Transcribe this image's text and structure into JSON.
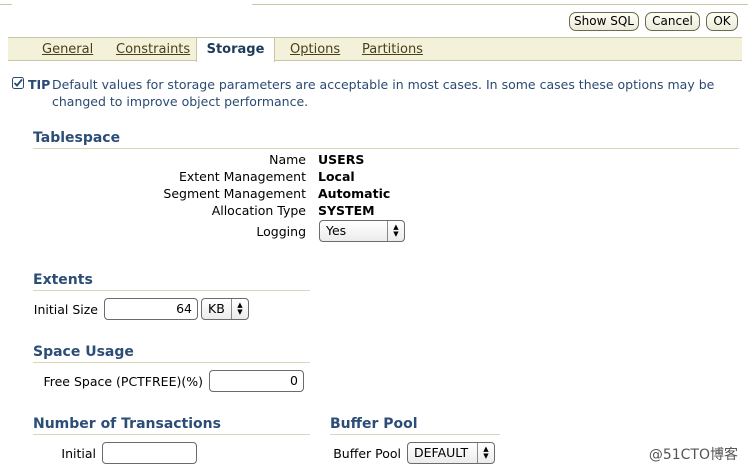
{
  "header": {
    "show_sql": "Show SQL",
    "cancel": "Cancel",
    "ok": "OK"
  },
  "tabs": {
    "general": "General",
    "constraints": "Constraints",
    "storage": "Storage",
    "options": "Options",
    "partitions": "Partitions"
  },
  "tip": {
    "label": "TIP",
    "text": "Default values for storage parameters are acceptable in most cases. In some cases these options may be changed to improve object performance."
  },
  "tablespace": {
    "title": "Tablespace",
    "name_label": "Name",
    "name_value": "USERS",
    "extent_label": "Extent Management",
    "extent_value": "Local",
    "segment_label": "Segment Management",
    "segment_value": "Automatic",
    "allocation_label": "Allocation Type",
    "allocation_value": "SYSTEM",
    "logging_label": "Logging",
    "logging_value": "Yes"
  },
  "extents": {
    "title": "Extents",
    "initial_size_label": "Initial Size",
    "initial_size_value": "64",
    "unit_value": "KB"
  },
  "space_usage": {
    "title": "Space Usage",
    "free_space_label": "Free Space (PCTFREE)(%)",
    "free_space_value": "0"
  },
  "transactions": {
    "title": "Number of Transactions",
    "initial_label": "Initial",
    "initial_value": ""
  },
  "buffer_pool": {
    "title": "Buffer Pool",
    "label": "Buffer Pool",
    "value": "DEFAULT"
  },
  "watermark": "@51CTO博客"
}
